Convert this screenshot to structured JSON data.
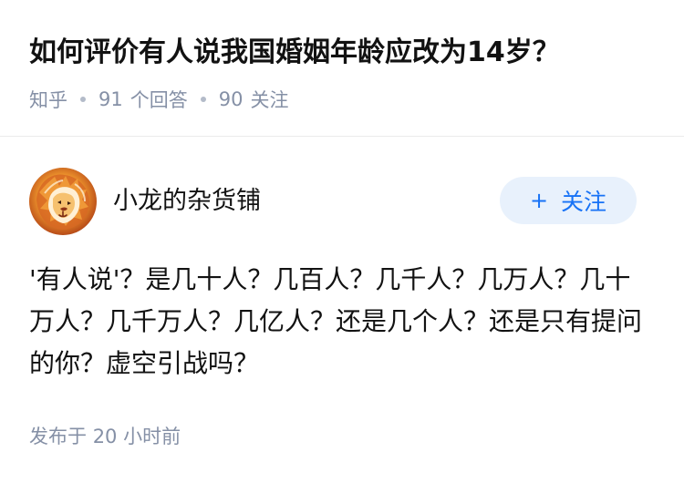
{
  "question": {
    "title": "如何评价有人说我国婚姻年龄应改为14岁？",
    "source": "知乎",
    "answer_count": "91",
    "answer_label": "个回答",
    "follower_count": "90",
    "follower_label": "关注"
  },
  "author": {
    "name": "小龙的杂货铺",
    "avatar_icon": "lion-avatar-icon"
  },
  "follow_button": {
    "icon": "+",
    "label": "关注"
  },
  "answer": {
    "content": "'有人说'？是几十人？几百人？几千人？几万人？几十万人？几千万人？几亿人？还是几个人？还是只有提问的你？虚空引战吗？",
    "published_label": "发布于",
    "published_time": "20 小时前"
  },
  "colors": {
    "primary_text": "#121212",
    "secondary_text": "#8590a6",
    "accent_blue": "#1772f6",
    "follow_button_background": "#e8f1fc",
    "divider": "#ebebeb"
  }
}
